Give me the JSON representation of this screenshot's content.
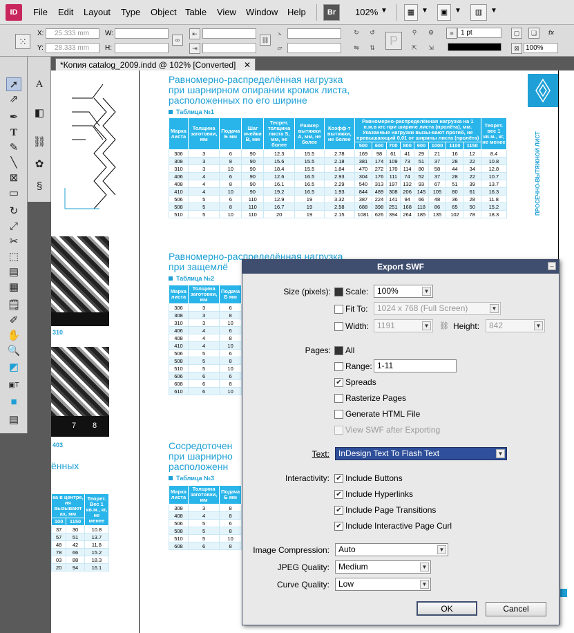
{
  "app": {
    "logo": "ID",
    "menu": [
      "File",
      "Edit",
      "Layout",
      "Type",
      "Object",
      "Table",
      "View",
      "Window",
      "Help"
    ],
    "bridge": "Br",
    "zoom": "102%"
  },
  "control": {
    "x_label": "X:",
    "x_value": "25.333 mm",
    "y_label": "Y:",
    "y_value": "28.333 mm",
    "w_label": "W:",
    "h_label": "H:",
    "stroke_weight": "1 pt",
    "opacity": "100%"
  },
  "document": {
    "tab_title": "*Копия catalog_2009.indd @ 102% [Converted]",
    "tab_close": "✕",
    "heading1": [
      "Равномерно-распределённая нагрузка",
      "при шарнирном опирании кромок листа,",
      "расположенных по его ширине"
    ],
    "table1_label": "Таблица №1",
    "table1_headers": [
      "Марка листа",
      "Толщина заготовки, мм",
      "Подача Б мм",
      "Шаг ячейки В, мм",
      "Теорет. толщина листа S, мм, не более",
      "Размер вытяжки А, мм, не более",
      "Коэфф-т вытяжки, не более",
      "Равномерно-распределённая нагрузка на 1 п.м.в кгс при ширине листа (пролёта), мм. Указанные нагрузки вызы-вают прогиб, не превышающий 0,01 от ширины листа (пролёта)",
      "Теорет. вес 1 кв.м., кг, не менее"
    ],
    "table1_spans": [
      "500",
      "600",
      "700",
      "800",
      "900",
      "1000",
      "1100",
      "1150"
    ],
    "table1_rows": [
      [
        "306",
        "3",
        "6",
        "90",
        "12.3",
        "15.5",
        "2.78",
        "169",
        "98",
        "61",
        "41",
        "29",
        "21",
        "16",
        "12",
        "8.4"
      ],
      [
        "308",
        "3",
        "8",
        "90",
        "15.6",
        "15.5",
        "2.18",
        "381",
        "174",
        "109",
        "73",
        "51",
        "37",
        "28",
        "22",
        "10.8"
      ],
      [
        "310",
        "3",
        "10",
        "90",
        "18.4",
        "15.5",
        "1.84",
        "470",
        "272",
        "170",
        "114",
        "80",
        "58",
        "44",
        "34",
        "12.8"
      ],
      [
        "406",
        "4",
        "6",
        "90",
        "12.6",
        "16.5",
        "2.93",
        "304",
        "176",
        "111",
        "74",
        "52",
        "37",
        "28",
        "22",
        "10.7"
      ],
      [
        "408",
        "4",
        "8",
        "90",
        "16.1",
        "16.5",
        "2.29",
        "540",
        "313",
        "197",
        "132",
        "93",
        "67",
        "51",
        "39",
        "13.7"
      ],
      [
        "410",
        "4",
        "10",
        "90",
        "19.2",
        "16.5",
        "1.93",
        "844",
        "489",
        "308",
        "206",
        "145",
        "105",
        "80",
        "61",
        "16.3"
      ],
      [
        "506",
        "5",
        "6",
        "110",
        "12.9",
        "19",
        "3.32",
        "387",
        "224",
        "141",
        "94",
        "66",
        "48",
        "36",
        "28",
        "11.8"
      ],
      [
        "508",
        "5",
        "8",
        "110",
        "16.7",
        "19",
        "2.58",
        "688",
        "398",
        "251",
        "168",
        "118",
        "86",
        "65",
        "50",
        "15.2"
      ],
      [
        "510",
        "5",
        "10",
        "110",
        "20",
        "19",
        "2.15",
        "1081",
        "626",
        "394",
        "264",
        "185",
        "135",
        "102",
        "78",
        "18.3"
      ]
    ],
    "heading2": [
      "Равномерно-распределённая нагрузка",
      "при защемлё"
    ],
    "table2_label": "Таблица №2",
    "table2_headers": [
      "Марка листа",
      "Толщина заготовки, мм",
      "Подача Б мм"
    ],
    "table2_rows": [
      [
        "306",
        "3",
        "6"
      ],
      [
        "308",
        "3",
        "8"
      ],
      [
        "310",
        "3",
        "10"
      ],
      [
        "406",
        "4",
        "6"
      ],
      [
        "408",
        "4",
        "8"
      ],
      [
        "410",
        "4",
        "10"
      ],
      [
        "506",
        "5",
        "6"
      ],
      [
        "508",
        "5",
        "8"
      ],
      [
        "510",
        "5",
        "10"
      ],
      [
        "606",
        "6",
        "6"
      ],
      [
        "608",
        "6",
        "8"
      ],
      [
        "610",
        "6",
        "10"
      ]
    ],
    "heading3": [
      "Сосредоточен",
      "при шарнирно",
      "расположенн"
    ],
    "table3_label": "Таблица №3",
    "table3_headers": [
      "Марка листа",
      "Толщина заготовки, мм",
      "Подача Б мм"
    ],
    "table3_rows": [
      [
        "308",
        "3",
        "8"
      ],
      [
        "408",
        "4",
        "8"
      ],
      [
        "506",
        "5",
        "6"
      ],
      [
        "508",
        "5",
        "8"
      ],
      [
        "510",
        "5",
        "10"
      ],
      [
        "608",
        "6",
        "8"
      ]
    ],
    "left_label1": "310",
    "left_label2": "403",
    "left_heading": "ённых",
    "left_table_headers": [
      "ка в центре, ия вызывают ах, мм",
      "Теорет. Вес 1 кв.м., кг, не менее"
    ],
    "left_table_sub": [
      "100",
      "1150"
    ],
    "left_table_rows": [
      [
        "37",
        "30",
        "10.8"
      ],
      [
        "57",
        "51",
        "13.7"
      ],
      [
        "48",
        "42",
        "11.8"
      ],
      [
        "78",
        "66",
        "15.2"
      ],
      [
        "03",
        "88",
        "18.3"
      ],
      [
        "20",
        "94",
        "16.1"
      ]
    ],
    "ruler_marks": [
      "7",
      "8"
    ],
    "side_vertical": "ПРОСЕЧНО-ВЫТЯЖНОЙ ЛИСТ"
  },
  "dialog": {
    "title": "Export SWF",
    "size_label": "Size (pixels):",
    "scale_label": "Scale:",
    "scale_value": "100%",
    "fit_label": "Fit To:",
    "fit_value": "1024 x 768 (Full Screen)",
    "width_label": "Width:",
    "width_value": "1191",
    "height_label": "Height:",
    "height_value": "842",
    "pages_label": "Pages:",
    "all_label": "All",
    "range_label": "Range:",
    "range_value": "1-11",
    "spreads_label": "Spreads",
    "rasterize_label": "Rasterize Pages",
    "html_label": "Generate HTML File",
    "view_label": "View SWF after Exporting",
    "text_label": "Text:",
    "text_value": "InDesign Text To Flash Text",
    "interactivity_label": "Interactivity:",
    "buttons_label": "Include Buttons",
    "hyperlinks_label": "Include Hyperlinks",
    "transitions_label": "Include Page Transitions",
    "curl_label": "Include Interactive Page Curl",
    "compression_label": "Image Compression:",
    "compression_value": "Auto",
    "jpeg_label": "JPEG Quality:",
    "jpeg_value": "Medium",
    "curve_label": "Curve Quality:",
    "curve_value": "Low",
    "ok": "OK",
    "cancel": "Cancel"
  }
}
